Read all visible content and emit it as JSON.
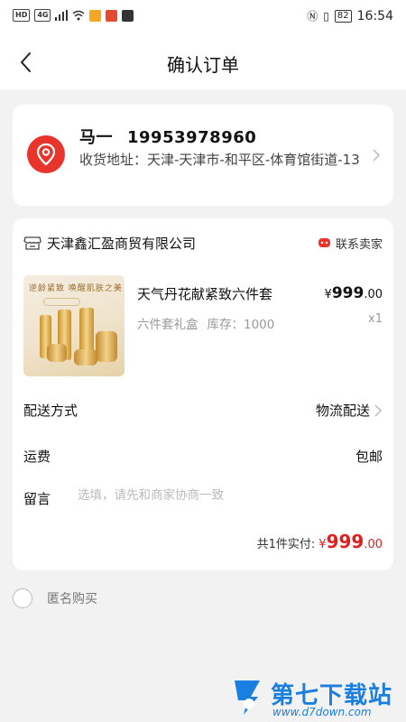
{
  "status_bar": {
    "left_chips": [
      "HD",
      "4G"
    ],
    "battery": "82",
    "time": "16:54"
  },
  "nav": {
    "title": "确认订单"
  },
  "address": {
    "name": "马一",
    "phone": "19953978960",
    "full_address": "收货地址：天津-天津市-和平区-体育馆街道-13"
  },
  "shop": {
    "name": "天津鑫汇盈商贸有限公司",
    "contact_label": "联系卖家"
  },
  "product": {
    "image_caption": "逆龄紧致 唤醒肌肤之美",
    "name": "天气丹花献紧致六件套",
    "price_symbol": "¥",
    "price_int": "999",
    "price_dec": ".00",
    "spec": "六件套礼盒",
    "stock": "库存：1000",
    "quantity": "x1"
  },
  "delivery": {
    "label": "配送方式",
    "value": "物流配送"
  },
  "freight": {
    "label": "运费",
    "value": "包邮"
  },
  "note": {
    "label": "留言",
    "placeholder": "选填，请先和商家协商一致"
  },
  "total": {
    "text": "共1件实付:",
    "symbol": "¥",
    "amount_int": "999",
    "amount_dec": ".00"
  },
  "anonymous": {
    "label": "匿名购买",
    "checked": false
  },
  "watermark": {
    "name": "第七下载站",
    "url": "www.d7down.com"
  },
  "colors": {
    "accent_red": "#e02020",
    "location_red": "#e8342b",
    "background": "#f2f2f2",
    "watermark_blue": "#1a7fe0"
  }
}
